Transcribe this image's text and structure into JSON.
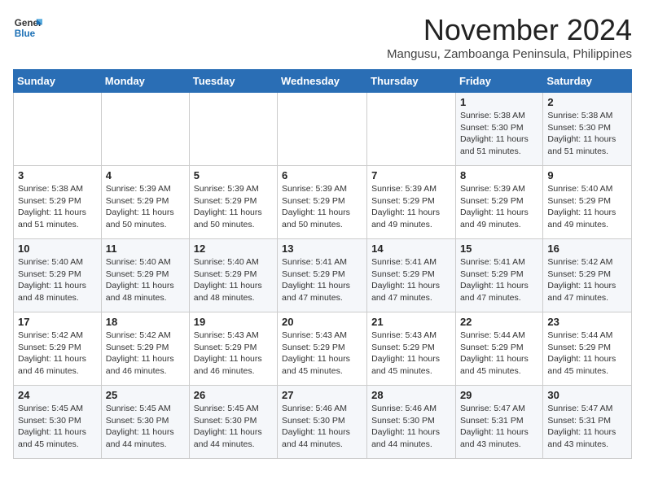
{
  "header": {
    "logo_general": "General",
    "logo_blue": "Blue",
    "month_year": "November 2024",
    "location": "Mangusu, Zamboanga Peninsula, Philippines"
  },
  "weekdays": [
    "Sunday",
    "Monday",
    "Tuesday",
    "Wednesday",
    "Thursday",
    "Friday",
    "Saturday"
  ],
  "weeks": [
    [
      {
        "day": "",
        "info": ""
      },
      {
        "day": "",
        "info": ""
      },
      {
        "day": "",
        "info": ""
      },
      {
        "day": "",
        "info": ""
      },
      {
        "day": "",
        "info": ""
      },
      {
        "day": "1",
        "info": "Sunrise: 5:38 AM\nSunset: 5:30 PM\nDaylight: 11 hours and 51 minutes."
      },
      {
        "day": "2",
        "info": "Sunrise: 5:38 AM\nSunset: 5:30 PM\nDaylight: 11 hours and 51 minutes."
      }
    ],
    [
      {
        "day": "3",
        "info": "Sunrise: 5:38 AM\nSunset: 5:29 PM\nDaylight: 11 hours and 51 minutes."
      },
      {
        "day": "4",
        "info": "Sunrise: 5:39 AM\nSunset: 5:29 PM\nDaylight: 11 hours and 50 minutes."
      },
      {
        "day": "5",
        "info": "Sunrise: 5:39 AM\nSunset: 5:29 PM\nDaylight: 11 hours and 50 minutes."
      },
      {
        "day": "6",
        "info": "Sunrise: 5:39 AM\nSunset: 5:29 PM\nDaylight: 11 hours and 50 minutes."
      },
      {
        "day": "7",
        "info": "Sunrise: 5:39 AM\nSunset: 5:29 PM\nDaylight: 11 hours and 49 minutes."
      },
      {
        "day": "8",
        "info": "Sunrise: 5:39 AM\nSunset: 5:29 PM\nDaylight: 11 hours and 49 minutes."
      },
      {
        "day": "9",
        "info": "Sunrise: 5:40 AM\nSunset: 5:29 PM\nDaylight: 11 hours and 49 minutes."
      }
    ],
    [
      {
        "day": "10",
        "info": "Sunrise: 5:40 AM\nSunset: 5:29 PM\nDaylight: 11 hours and 48 minutes."
      },
      {
        "day": "11",
        "info": "Sunrise: 5:40 AM\nSunset: 5:29 PM\nDaylight: 11 hours and 48 minutes."
      },
      {
        "day": "12",
        "info": "Sunrise: 5:40 AM\nSunset: 5:29 PM\nDaylight: 11 hours and 48 minutes."
      },
      {
        "day": "13",
        "info": "Sunrise: 5:41 AM\nSunset: 5:29 PM\nDaylight: 11 hours and 47 minutes."
      },
      {
        "day": "14",
        "info": "Sunrise: 5:41 AM\nSunset: 5:29 PM\nDaylight: 11 hours and 47 minutes."
      },
      {
        "day": "15",
        "info": "Sunrise: 5:41 AM\nSunset: 5:29 PM\nDaylight: 11 hours and 47 minutes."
      },
      {
        "day": "16",
        "info": "Sunrise: 5:42 AM\nSunset: 5:29 PM\nDaylight: 11 hours and 47 minutes."
      }
    ],
    [
      {
        "day": "17",
        "info": "Sunrise: 5:42 AM\nSunset: 5:29 PM\nDaylight: 11 hours and 46 minutes."
      },
      {
        "day": "18",
        "info": "Sunrise: 5:42 AM\nSunset: 5:29 PM\nDaylight: 11 hours and 46 minutes."
      },
      {
        "day": "19",
        "info": "Sunrise: 5:43 AM\nSunset: 5:29 PM\nDaylight: 11 hours and 46 minutes."
      },
      {
        "day": "20",
        "info": "Sunrise: 5:43 AM\nSunset: 5:29 PM\nDaylight: 11 hours and 45 minutes."
      },
      {
        "day": "21",
        "info": "Sunrise: 5:43 AM\nSunset: 5:29 PM\nDaylight: 11 hours and 45 minutes."
      },
      {
        "day": "22",
        "info": "Sunrise: 5:44 AM\nSunset: 5:29 PM\nDaylight: 11 hours and 45 minutes."
      },
      {
        "day": "23",
        "info": "Sunrise: 5:44 AM\nSunset: 5:29 PM\nDaylight: 11 hours and 45 minutes."
      }
    ],
    [
      {
        "day": "24",
        "info": "Sunrise: 5:45 AM\nSunset: 5:30 PM\nDaylight: 11 hours and 45 minutes."
      },
      {
        "day": "25",
        "info": "Sunrise: 5:45 AM\nSunset: 5:30 PM\nDaylight: 11 hours and 44 minutes."
      },
      {
        "day": "26",
        "info": "Sunrise: 5:45 AM\nSunset: 5:30 PM\nDaylight: 11 hours and 44 minutes."
      },
      {
        "day": "27",
        "info": "Sunrise: 5:46 AM\nSunset: 5:30 PM\nDaylight: 11 hours and 44 minutes."
      },
      {
        "day": "28",
        "info": "Sunrise: 5:46 AM\nSunset: 5:30 PM\nDaylight: 11 hours and 44 minutes."
      },
      {
        "day": "29",
        "info": "Sunrise: 5:47 AM\nSunset: 5:31 PM\nDaylight: 11 hours and 43 minutes."
      },
      {
        "day": "30",
        "info": "Sunrise: 5:47 AM\nSunset: 5:31 PM\nDaylight: 11 hours and 43 minutes."
      }
    ]
  ]
}
